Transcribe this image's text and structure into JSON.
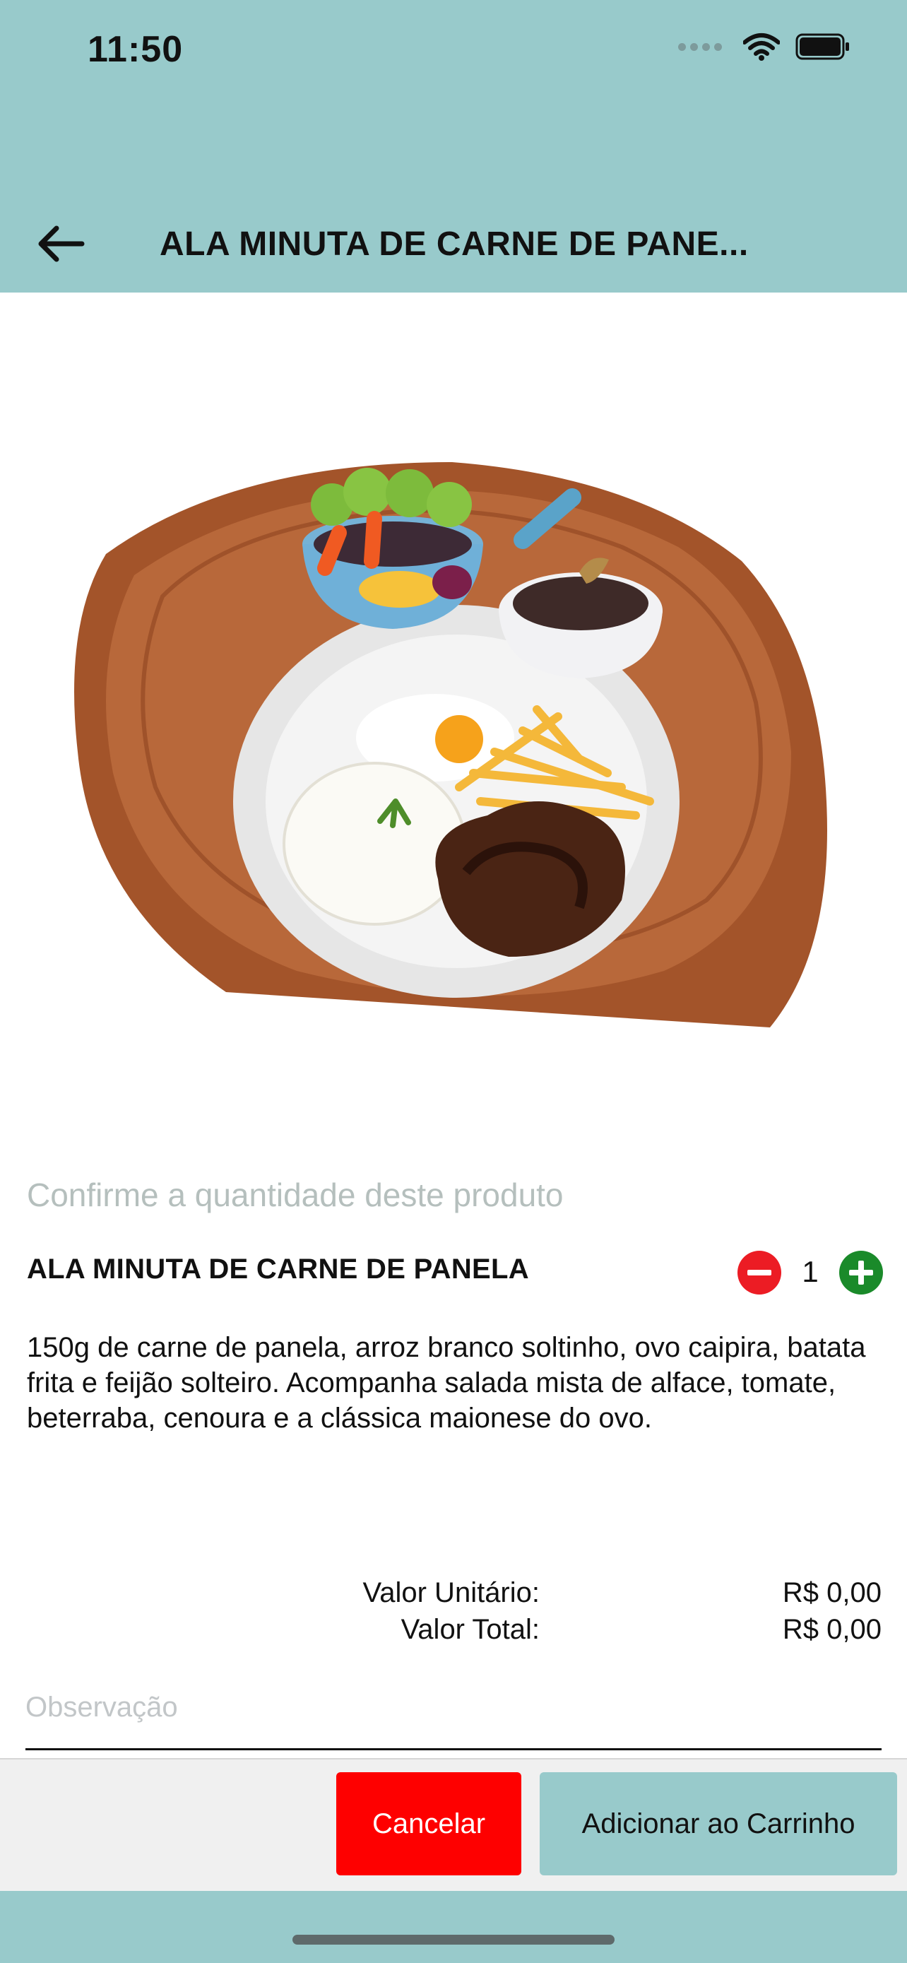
{
  "status_bar": {
    "time": "11:50"
  },
  "nav": {
    "title": "ALA MINUTA DE CARNE DE PANE..."
  },
  "hero": {
    "image": "plated-meal-photo"
  },
  "hint": "Confirme a quantidade deste produto",
  "product": {
    "name": "ALA MINUTA DE CARNE DE PANELA",
    "quantity": "1",
    "description": "150g de carne de panela, arroz branco soltinho, ovo caipira, batata frita e feijão solteiro. Acompanha salada mista de alface, tomate, beterraba, cenoura e a clássica maionese do ovo."
  },
  "prices": {
    "unit_label": "Valor Unitário:",
    "unit_value": "R$ 0,00",
    "total_label": "Valor Total:",
    "total_value": "R$ 0,00"
  },
  "observation": {
    "placeholder": "Observação",
    "value": ""
  },
  "buttons": {
    "cancel": "Cancelar",
    "add": "Adicionar ao Carrinho"
  },
  "colors": {
    "header": "#98cacb",
    "cancel": "#fe0000",
    "minus": "#ec1c24",
    "plus": "#1a8a2a"
  }
}
